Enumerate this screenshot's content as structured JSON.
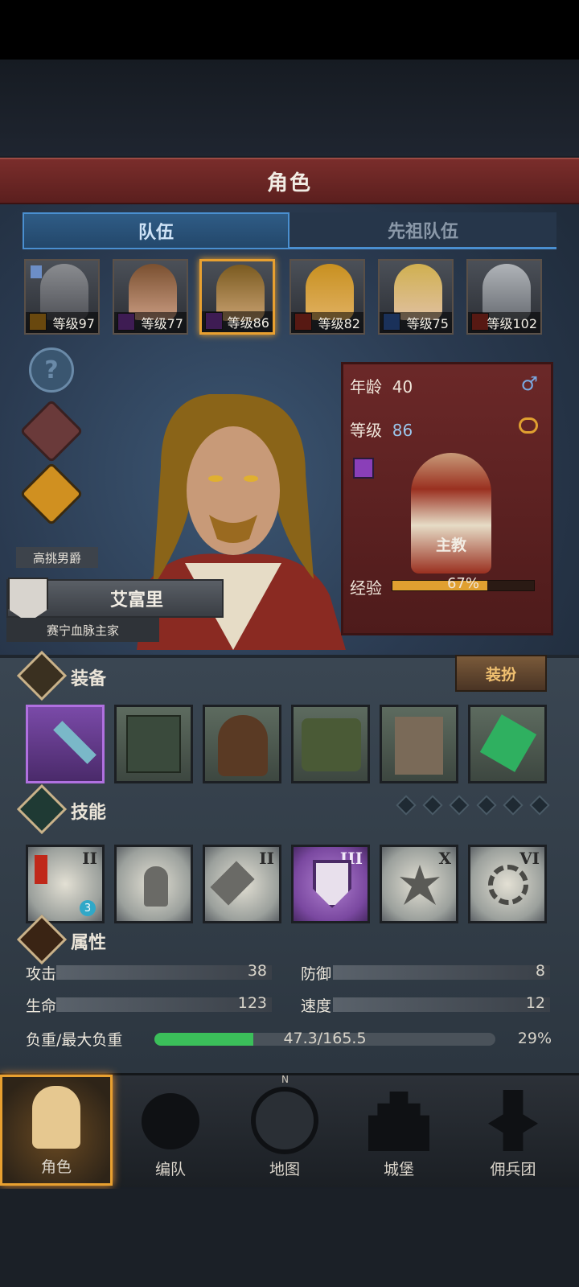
{
  "header": {
    "title": "角色"
  },
  "tabs": [
    {
      "label": "队伍"
    },
    {
      "label": "先祖队伍"
    }
  ],
  "roster": [
    {
      "level_label": "等级97",
      "class_color": "#e8a020"
    },
    {
      "level_label": "等级77",
      "class_color": "#8a3fb8"
    },
    {
      "level_label": "等级86",
      "class_color": "#8a3fb8"
    },
    {
      "level_label": "等级82",
      "class_color": "#c2382a"
    },
    {
      "level_label": "等级75",
      "class_color": "#3a6ec8"
    },
    {
      "level_label": "等级102",
      "class_color": "#c2382a"
    }
  ],
  "character": {
    "name": "艾富里",
    "title": "高挑男爵",
    "house": "赛宁血脉主家",
    "age_label": "年龄",
    "age": "40",
    "level_label": "等级",
    "level": "86",
    "class_name": "主教",
    "exp_label": "经验",
    "exp_text": "67%",
    "exp_fraction": 0.67
  },
  "equipment": {
    "title": "装备",
    "dress_button": "装扮"
  },
  "skills": {
    "title": "技能",
    "ranks": [
      "II",
      "",
      "II",
      "III",
      "X",
      "VI"
    ],
    "badge": "3"
  },
  "attributes": {
    "title": "属性",
    "attack_label": "攻击",
    "attack": "38",
    "defense_label": "防御",
    "defense": "8",
    "life_label": "生命",
    "life": "123",
    "speed_label": "速度",
    "speed": "12",
    "load_label": "负重/最大负重",
    "load_text": "47.3/165.5",
    "load_percent": "29%",
    "load_fraction": 0.29
  },
  "nav": [
    {
      "label": "角色"
    },
    {
      "label": "编队"
    },
    {
      "label": "地图"
    },
    {
      "label": "城堡"
    },
    {
      "label": "佣兵团"
    }
  ],
  "nav_compass_letter": "N",
  "colors": {
    "accent": "#e8a030",
    "tab_blue": "#4a8fd0",
    "header_red": "#7a2d2b",
    "exp_bar": "#e0a030",
    "load_bar": "#3bbf5a"
  }
}
